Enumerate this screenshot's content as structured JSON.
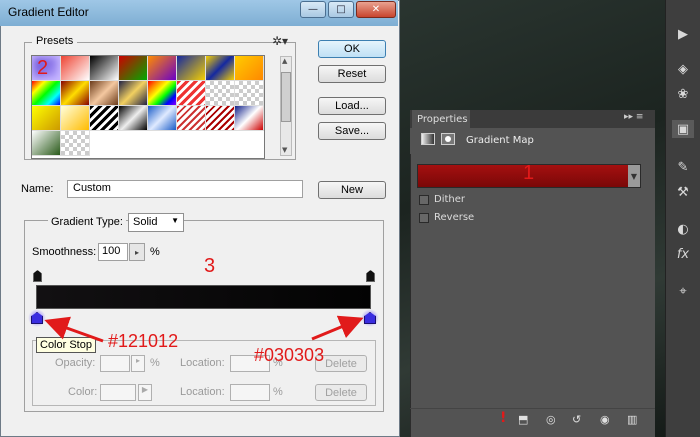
{
  "dialog": {
    "title": "Gradient Editor",
    "presets_label": "Presets",
    "gear_glyph": "✲▾",
    "buttons": {
      "ok": "OK",
      "cancel": "Reset",
      "load": "Load...",
      "save": "Save...",
      "new": "New"
    },
    "name_label": "Name:",
    "name_value": "Custom",
    "gradient_type_label": "Gradient Type:",
    "gradient_type_value": "Solid",
    "smoothness_label": "Smoothness:",
    "smoothness_value": "100",
    "smoothness_unit": "%",
    "stops": {
      "opacity_label": "Opacity:",
      "opacity_unit": "%",
      "location_label": "Location:",
      "location_unit": "%",
      "color_label": "Color:",
      "delete_label": "Delete"
    },
    "tooltip": "Color Stop",
    "window_controls": {
      "minimize": "—",
      "maximize": "□",
      "close": "✕"
    }
  },
  "annotations": {
    "num_1": "1",
    "num_2": "2",
    "num_3": "3",
    "left_color": "#121012",
    "right_color": "#030303"
  },
  "properties": {
    "tab_label": "Properties",
    "header_title": "Gradient Map",
    "dither_label": "Dither",
    "reverse_label": "Reverse",
    "tab_menu_glyphs": "▸▸ ≡"
  },
  "colors": {
    "gradient_left": "#121012",
    "gradient_right": "#030303",
    "accent_red": "#e11a1a",
    "gradient_map_preview": "#a51010",
    "stop_color": "#3a2de0"
  },
  "icons": {
    "toolbar": [
      "play-icon",
      "layers-icon",
      "channels-icon",
      "adjustments-icon",
      "brush-icon",
      "tool-presets-icon",
      "styles-icon",
      "fx-icon",
      "paths-icon"
    ],
    "props_footer": [
      "clip-icon",
      "view-previous-icon",
      "reset-icon",
      "visibility-icon",
      "trash-icon"
    ]
  }
}
